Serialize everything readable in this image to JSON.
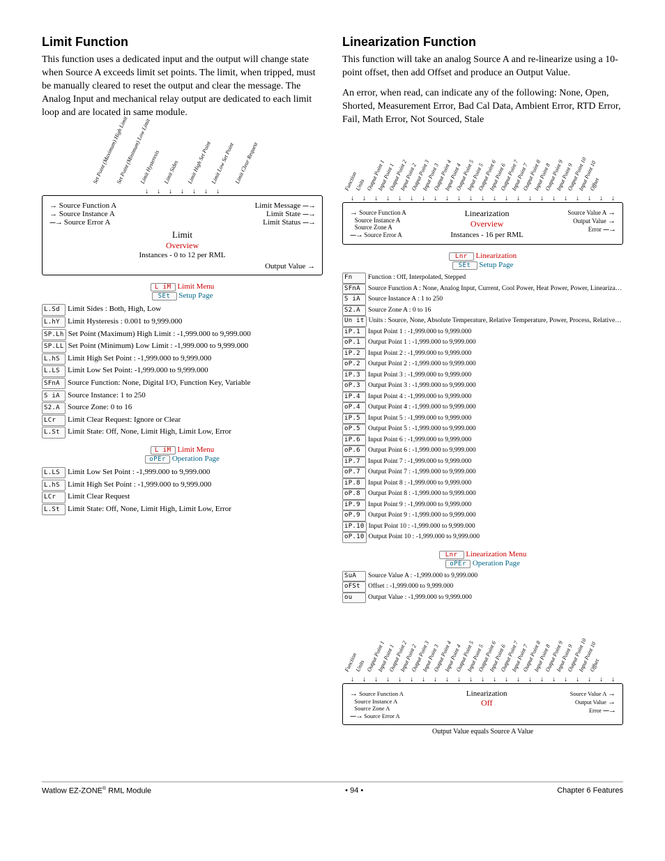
{
  "left": {
    "heading": "Limit Function",
    "para1": "This function uses a dedicated input and the output will change state when Source A exceeds limit set points. The limit, when tripped, must be manually cleared to reset the output and clear the message. The Analog Input and mechanical relay output are dedicated to each limit loop and are located in same module.",
    "curved": [
      "Set Point (Maximum) High Limit",
      "Set Point (Minimum) Low Limit",
      "Limit Hysteresis",
      "Limit Sides",
      "Limit High Set Point",
      "Limit Low Set Point",
      "Limit Clear Request"
    ],
    "block": {
      "in1": "Source Function A",
      "in2": "Source Instance A",
      "in3": "Source Error A",
      "out1": "Limit Message",
      "out2": "Limit State",
      "out3": "Limit Status",
      "title": "Limit",
      "overview": "Overview",
      "instances": "Instances - 0 to 12 per RML",
      "below": "Output Value"
    },
    "menu1": {
      "seg1": "L iM",
      "t1": "Limit Menu",
      "seg2": "SEt",
      "t2": "Setup Page"
    },
    "setup_params": [
      {
        "seg": "L.Sd",
        "txt": "Limit Sides : Both, High, Low"
      },
      {
        "seg": "L.hY",
        "txt": "Limit Hysteresis : 0.001 to 9,999.000"
      },
      {
        "seg": "SP.Lh",
        "txt": "Set Point (Maximum) High Limit : -1,999.000 to 9,999.000"
      },
      {
        "seg": "SP.LL",
        "txt": "Set Point (Minimum) Low Limit : -1,999.000 to 9,999.000"
      },
      {
        "seg": "L.hS",
        "txt": "Limit High Set Point : -1,999.000 to 9,999.000"
      },
      {
        "seg": "L.LS",
        "txt": "Limit Low Set Point: -1,999.000 to 9,999.000"
      },
      {
        "seg": "SFnA",
        "txt": "Source Function: None, Digital I/O, Function Key, Variable"
      },
      {
        "seg": "S iA",
        "txt": "Source Instance: 1 to 250"
      },
      {
        "seg": "S2.A",
        "txt": "Source Zone: 0 to 16"
      },
      {
        "seg": "LCr",
        "txt": "Limit Clear Request: Ignore or Clear"
      },
      {
        "seg": "L.St",
        "txt": "Limit State: Off, None, Limit High, Limit Low, Error"
      }
    ],
    "menu2": {
      "seg1": "L iM",
      "t1": "Limit Menu",
      "seg2": "oPEr",
      "t2": "Operation Page"
    },
    "oper_params": [
      {
        "seg": "L.LS",
        "txt": "Limit Low Set Point : -1,999.000 to 9,999.000"
      },
      {
        "seg": "L.hS",
        "txt": "Limit High Set Point : -1,999.000 to 9,999.000"
      },
      {
        "seg": "LCr",
        "txt": "Limit Clear Request"
      },
      {
        "seg": "L.St",
        "txt": "Limit State: Off, None, Limit High, Limit Low, Error"
      }
    ]
  },
  "right": {
    "heading": "Linearization Function",
    "para1": "This function will take an analog Source A and re-linearize using a 10-point offset, then add Offset and produce an Output Value.",
    "para2": "An error, when read, can indicate any of the following: None, Open, Shorted, Measurement Error, Bad Cal Data, Ambient Error, RTD Error, Fail, Math Error, Not Sourced, Stale",
    "curved": [
      "Function",
      "Units",
      "Output Point 1",
      "Input Point 1",
      "Output Point 2",
      "Input Point 2",
      "Output Point 3",
      "Input Point 3",
      "Output Point 4",
      "Input Point 4",
      "Output Point 5",
      "Input Point 5",
      "Output Point 6",
      "Input Point 6",
      "Output Point 7",
      "Input Point 7",
      "Output Point 8",
      "Input Point 8",
      "Output Point 9",
      "Input Point 9",
      "Output Point 10",
      "Input Point 10",
      "Offset"
    ],
    "block": {
      "in1": "Source Function A",
      "in2": "Source Instance A",
      "in3": "Source Zone A",
      "in4": "Source Error A",
      "out1": "Source Value A",
      "out2": "Output Value",
      "out3": "Error",
      "title": "Linearization",
      "overview": "Overview",
      "instances": "Instances - 16 per RML"
    },
    "menu1": {
      "seg1": "Lnr",
      "t1": "Linearization",
      "seg2": "SEt",
      "t2": "Setup Page"
    },
    "setup_params": [
      {
        "seg": "Fn",
        "txt": "Function : Off, Interpolated, Stepped"
      },
      {
        "seg": "SFnA",
        "txt": "Source Function A : None, Analog Input, Current, Cool Power, Heat Power, Power, Linearization, Math, Process Value, Set Point Closed, Set Point Open, Variable"
      },
      {
        "seg": "S iA",
        "txt": "Source Instance A : 1 to 250"
      },
      {
        "seg": "S2.A",
        "txt": "Source Zone A : 0 to 16"
      },
      {
        "seg": "Un it",
        "txt": "Units : Source, None, Absolute Temperature, Relative Temperature, Power, Process, Relative Humidity"
      },
      {
        "seg": "iP.1",
        "txt": "Input Point 1 : -1,999.000 to 9,999.000"
      },
      {
        "seg": "oP.1",
        "txt": "Output Point 1 : -1,999.000 to 9,999.000"
      },
      {
        "seg": "iP.2",
        "txt": "Input Point 2 : -1,999.000 to 9,999.000"
      },
      {
        "seg": "oP.2",
        "txt": "Output Point 2 : -1,999.000 to 9,999.000"
      },
      {
        "seg": "iP.3",
        "txt": "Input Point 3 : -1,999.000 to 9,999.000"
      },
      {
        "seg": "oP.3",
        "txt": "Output Point 3 : -1,999.000 to 9,999.000"
      },
      {
        "seg": "iP.4",
        "txt": "Input Point 4 : -1,999.000 to 9,999.000"
      },
      {
        "seg": "oP.4",
        "txt": "Output Point 4 : -1,999.000 to 9,999.000"
      },
      {
        "seg": "iP.5",
        "txt": "Input Point 5 : -1,999.000 to 9,999.000"
      },
      {
        "seg": "oP.5",
        "txt": "Output Point 5 : -1,999.000 to 9,999.000"
      },
      {
        "seg": "iP.6",
        "txt": "Input Point 6 : -1,999.000 to 9,999.000"
      },
      {
        "seg": "oP.6",
        "txt": "Output Point 6 : -1,999.000 to 9,999.000"
      },
      {
        "seg": "iP.7",
        "txt": "Input Point 7 : -1,999.000 to 9,999.000"
      },
      {
        "seg": "oP.7",
        "txt": "Output Point 7 : -1,999.000 to 9,999.000"
      },
      {
        "seg": "iP.8",
        "txt": "Input Point 8 : -1,999.000 to 9,999.000"
      },
      {
        "seg": "oP.8",
        "txt": "Output Point 8 : -1,999.000 to 9,999.000"
      },
      {
        "seg": "iP.9",
        "txt": "Input Point 9 : -1,999.000 to 9,999.000"
      },
      {
        "seg": "oP.9",
        "txt": "Output Point 9 : -1,999.000 to 9,999.000"
      },
      {
        "seg": "iP.10",
        "txt": "Input Point 10 : -1,999.000 to 9,999.000"
      },
      {
        "seg": "oP.10",
        "txt": "Output Point 10 : -1,999.000 to 9,999.000"
      }
    ],
    "menu2": {
      "seg1": "Lnr",
      "t1": "Linearization Menu",
      "seg2": "oPEr",
      "t2": "Operation Page"
    },
    "oper_params": [
      {
        "seg": "SuA",
        "txt": "Source Value A : -1,999.000 to 9,999.000"
      },
      {
        "seg": "oFSt",
        "txt": "Offset : -1,999.000 to 9,999.000"
      },
      {
        "seg": "ou",
        "txt": "Output Value : -1,999.000 to 9,999.000"
      }
    ],
    "block2": {
      "title": "Linearization",
      "mode": "Off",
      "caption": "Output Value equals Source A Value"
    }
  },
  "footer": {
    "left": "Watlow EZ-ZONE",
    "sup": "®",
    "left2": " RML Module",
    "mid": "•  94  •",
    "right": "Chapter 6 Features"
  }
}
